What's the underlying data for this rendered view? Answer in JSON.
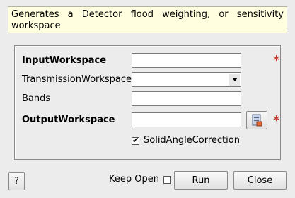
{
  "description": "Generates a Detector flood weighting, or sensitivity workspace",
  "fields": {
    "input_workspace": {
      "label": "InputWorkspace",
      "value": ""
    },
    "transmission_workspace": {
      "label": "TransmissionWorkspace",
      "value": ""
    },
    "bands": {
      "label": "Bands",
      "value": ""
    },
    "output_workspace": {
      "label": "OutputWorkspace",
      "value": ""
    }
  },
  "mandatory_marker": "*",
  "solid_angle": {
    "label": "SolidAngleCorrection",
    "checked": true,
    "mark": "✔"
  },
  "footer": {
    "help_label": "?",
    "keep_open_label": "Keep Open",
    "keep_open_checked": false,
    "run_label": "Run",
    "close_label": "Close"
  },
  "icons": {
    "browse": "workspace-browse-icon",
    "combo": "chevron-down-icon"
  },
  "colors": {
    "description_bg": "#ffffe0",
    "mandatory": "#c0392b"
  }
}
